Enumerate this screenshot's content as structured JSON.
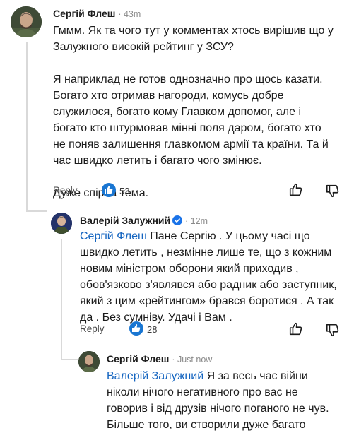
{
  "comments": [
    {
      "author": "Сергій Флеш",
      "meta": "· 43m",
      "paragraphs": [
        "Гммм. Як та чого тут у комментах хтось вирішив що у Залужного високій рейтинг у ЗСУ?",
        "Я наприклад не готов однозначно про щось казати. Богато хто отримав нагороди, комусь добре служилося, богато кому Главком допомог, але і богато кто штурмовав мінні поля даром, богато хто не поняв залишення главкомом армії та країни. Та й час швидко летить і багато чого змінює.",
        "Дуже спірна тема."
      ],
      "reply_label": "Reply",
      "likes": "53"
    },
    {
      "author": "Валерій Залужний",
      "meta": "· 12m",
      "mention": "Сергій Флеш",
      "text": " Пане Сергію . У цьому часі що швидко летить , незмінне лише те, що з кожним новим міністром оборони який приходив , обов'язково з'являвся або радник або заступник, який з цим «рейтингом» брався боротися . А так да . Без сумніву. Удачі і Вам .",
      "reply_label": "Reply",
      "likes": "28"
    },
    {
      "author": "Сергій Флеш",
      "meta": "· Just now",
      "mention": "Валерій Залужний",
      "text": " Я за весь час війни ніколи нічого негативного про вас не говорив і від друзів нічого поганого не чув.",
      "text2": "Більше того, ви створили дуже багато"
    }
  ],
  "colors": {
    "mention": "#1565c0",
    "like_badge": "#1976d2"
  }
}
